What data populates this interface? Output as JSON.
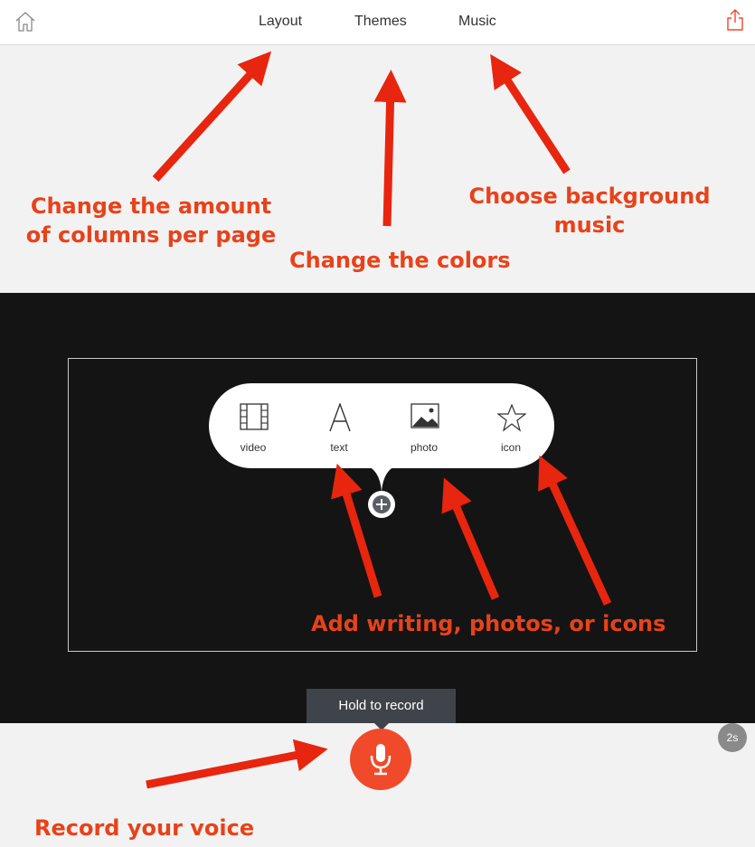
{
  "topbar": {
    "tabs": [
      {
        "label": "Layout"
      },
      {
        "label": "Themes"
      },
      {
        "label": "Music"
      }
    ]
  },
  "add_menu": {
    "items": [
      {
        "label": "video",
        "icon": "film-icon"
      },
      {
        "label": "text",
        "icon": "text-a-icon"
      },
      {
        "label": "photo",
        "icon": "image-icon"
      },
      {
        "label": "icon",
        "icon": "star-icon"
      }
    ]
  },
  "record": {
    "tooltip": "Hold to record",
    "timer": "2s"
  },
  "annotations": {
    "layout": "Change the amount of columns per page",
    "themes": "Change the colors",
    "music": "Choose background music",
    "add": "Add writing, photos, or icons",
    "record": "Record your voice"
  },
  "colors": {
    "accent": "#f04a2a",
    "annotation": "#e8421a",
    "stage": "#141414"
  }
}
